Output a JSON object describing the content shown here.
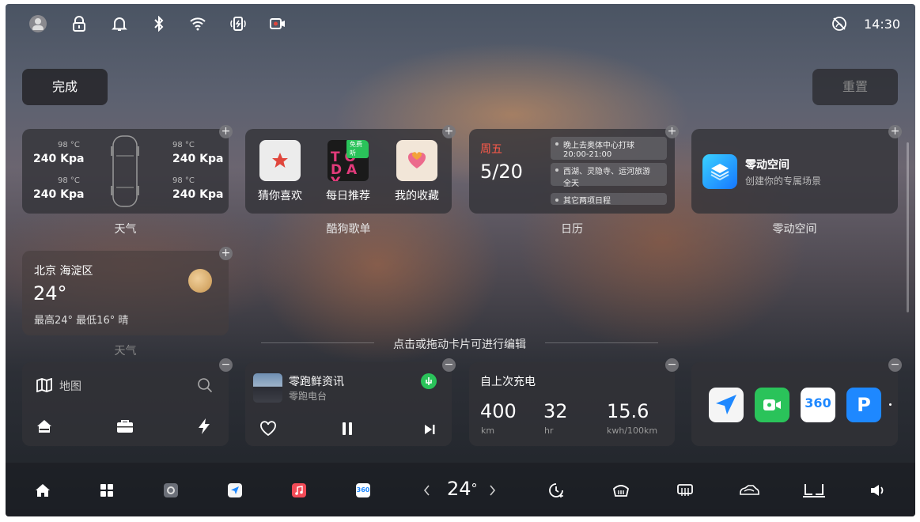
{
  "status_bar": {
    "time": "14:30"
  },
  "buttons": {
    "done": "完成",
    "reset": "重置"
  },
  "weather_tire": {
    "fl_temp": "98 °C",
    "fl_pressure": "240 Kpa",
    "fr_temp": "98 °C",
    "fr_pressure": "240 Kpa",
    "rl_temp": "98 °C",
    "rl_pressure": "240 Kpa",
    "rr_temp": "98 °C",
    "rr_pressure": "240 Kpa",
    "caption": "天气"
  },
  "kugou": {
    "items": [
      "猜你喜欢",
      "每日推荐",
      "我的收藏"
    ],
    "badge": "免费听",
    "caption": "酷狗歌单"
  },
  "calendar": {
    "weekday": "周五",
    "date": "5/20",
    "events": [
      {
        "title": "晚上去奥体中心打球",
        "time": "20:00-21:00"
      },
      {
        "title": "西湖、灵隐寺、运河旅游",
        "time": "全天"
      },
      {
        "title": "其它两项日程",
        "time": ""
      }
    ],
    "caption": "日历"
  },
  "space": {
    "title": "零动空间",
    "subtitle": "创建你的专属场景",
    "caption": "零动空间"
  },
  "weather": {
    "location": "北京 海淀区",
    "temp": "24°",
    "range": "最高24° 最低16° 晴",
    "caption": "天气"
  },
  "hint": "点击或拖动卡片可进行编辑",
  "map": {
    "label": "地图"
  },
  "radio": {
    "title": "零跑鲜资讯",
    "subtitle": "零跑电台"
  },
  "charge": {
    "title": "自上次充电",
    "stats": [
      {
        "value": "400",
        "unit": "km"
      },
      {
        "value": "32",
        "unit": "hr"
      },
      {
        "value": "15.6",
        "unit": "kwh/100km"
      }
    ]
  },
  "dock": {
    "temperature": "24",
    "temp_unit": "°",
    "app_360": "360"
  },
  "colors": {
    "accent_red": "#e0463c",
    "card_bg": "rgba(50,50,55,0.78)",
    "blue_app": "#1e88ff",
    "green_app": "#2ac35a"
  }
}
